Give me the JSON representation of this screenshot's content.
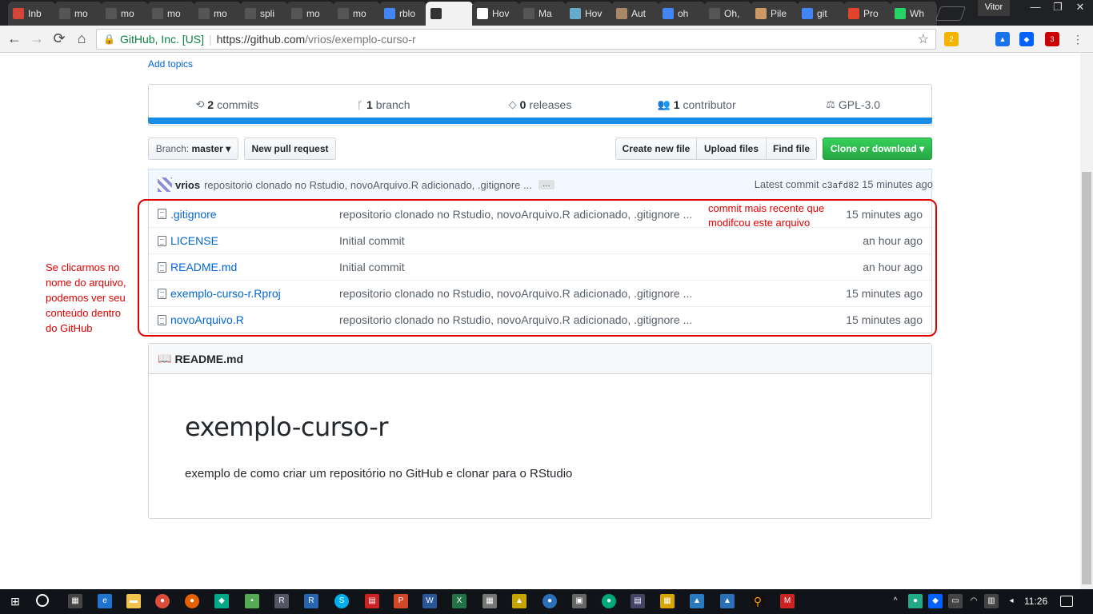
{
  "browser": {
    "tabs": [
      {
        "label": "Inb",
        "color": "#d44638"
      },
      {
        "label": "mo",
        "color": "#555555"
      },
      {
        "label": "mo",
        "color": "#555555"
      },
      {
        "label": "mo",
        "color": "#555555"
      },
      {
        "label": "mo",
        "color": "#555555"
      },
      {
        "label": "spli",
        "color": "#555555"
      },
      {
        "label": "mo",
        "color": "#555555"
      },
      {
        "label": "mo",
        "color": "#555555"
      },
      {
        "label": "rblo",
        "color": "#4285f4"
      },
      {
        "label": "",
        "color": "#333333"
      },
      {
        "label": "Hov",
        "color": "#ffffff"
      },
      {
        "label": "Ma",
        "color": "#555555"
      },
      {
        "label": "Hov",
        "color": "#6ac"
      },
      {
        "label": "Aut",
        "color": "#a86"
      },
      {
        "label": "oh",
        "color": "#4285f4"
      },
      {
        "label": "Oh,",
        "color": "#555555"
      },
      {
        "label": "Pile",
        "color": "#c96"
      },
      {
        "label": "git",
        "color": "#4285f4"
      },
      {
        "label": "Pro",
        "color": "#e2432a"
      },
      {
        "label": "Wh",
        "color": "#25d366"
      }
    ],
    "profile_name": "Vitor",
    "secure_label": "GitHub, Inc. [US]",
    "url_host": "https://github.com",
    "url_path": "/vrios/exemplo-curso-r"
  },
  "repo": {
    "add_topics": "Add topics",
    "summary": [
      {
        "icon": "commits-icon",
        "glyph": "⟲",
        "count": "2",
        "label": "commits"
      },
      {
        "icon": "branch-icon",
        "glyph": "ᚴ",
        "count": "1",
        "label": "branch"
      },
      {
        "icon": "tag-icon",
        "glyph": "◇",
        "count": "0",
        "label": "releases"
      },
      {
        "icon": "people-icon",
        "glyph": "👥",
        "count": "1",
        "label": "contributor"
      },
      {
        "icon": "law-icon",
        "glyph": "⚖",
        "count": "",
        "label": "GPL-3.0"
      }
    ],
    "branch_label": "Branch:",
    "branch_value": "master",
    "new_pr": "New pull request",
    "create_file": "Create new file",
    "upload_files": "Upload files",
    "find_file": "Find file",
    "clone": "Clone or download",
    "commit": {
      "author": "vrios",
      "message": "repositorio clonado no Rstudio, novoArquivo.R adicionado, .gitignore ...",
      "ellipsis": "…",
      "latest_label": "Latest commit",
      "sha": "c3afd82",
      "age": "15 minutes ago"
    },
    "files": [
      {
        "name": ".gitignore",
        "message": "repositorio clonado no Rstudio, novoArquivo.R adicionado, .gitignore ...",
        "age": "15 minutes ago"
      },
      {
        "name": "LICENSE",
        "message": "Initial commit",
        "age": "an hour ago"
      },
      {
        "name": "README.md",
        "message": "Initial commit",
        "age": "an hour ago"
      },
      {
        "name": "exemplo-curso-r.Rproj",
        "message": "repositorio clonado no Rstudio, novoArquivo.R adicionado, .gitignore ...",
        "age": "15 minutes ago"
      },
      {
        "name": "novoArquivo.R",
        "message": "repositorio clonado no Rstudio, novoArquivo.R adicionado, .gitignore ...",
        "age": "15 minutes ago"
      }
    ],
    "readme_header": "README.md",
    "readme_title": "exemplo-curso-r",
    "readme_text": "exemplo de como criar um repositório no GitHub e clonar para o RStudio"
  },
  "annotations": {
    "right_line1": "commit mais recente que",
    "right_line2": "modifcou este arquivo",
    "left_lines": [
      "Se clicarmos no",
      "nome do arquivo,",
      "podemos ver seu",
      "conteúdo dentro",
      "do GitHub"
    ],
    "color": "#e00000"
  },
  "taskbar": {
    "time": "11:26"
  }
}
